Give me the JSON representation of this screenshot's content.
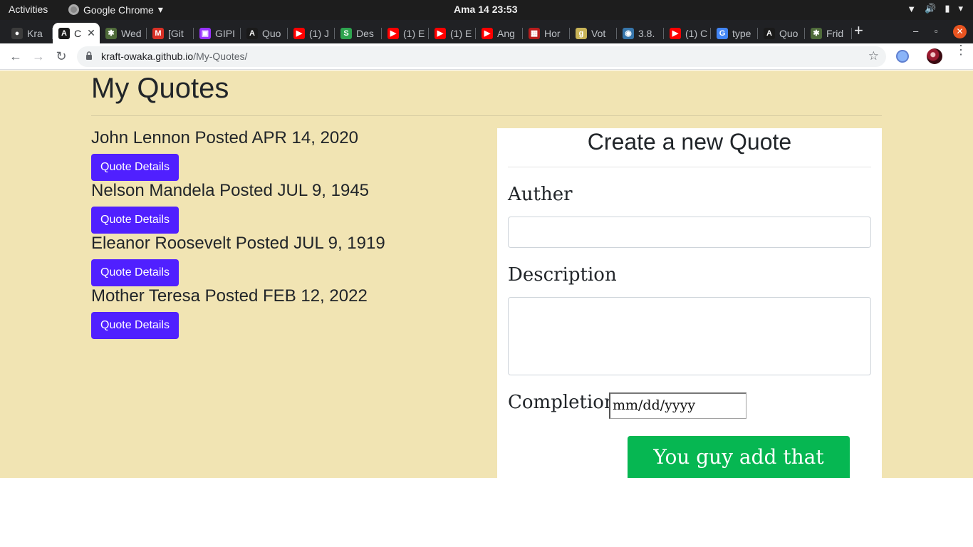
{
  "system_bar": {
    "activities": "Activities",
    "app_name": "Google Chrome",
    "clock": "Ama 14  23:53"
  },
  "tabs": [
    {
      "label": "Kra",
      "icon": "github-icon",
      "color": "#3c3c3c"
    },
    {
      "label": "C",
      "icon": "angular-icon",
      "color": "#1a1a1a",
      "active": true
    },
    {
      "label": "Wed",
      "icon": "palm-icon",
      "color": "#4f6b3a"
    },
    {
      "label": "[Git",
      "icon": "gmail-icon",
      "color": "#d93025"
    },
    {
      "label": "GIPI",
      "icon": "giphy-icon",
      "color": "#9933ff"
    },
    {
      "label": "Quo",
      "icon": "angular-icon",
      "color": "#1a1a1a"
    },
    {
      "label": "(1) J",
      "icon": "youtube-icon",
      "color": "#ff0000"
    },
    {
      "label": "Des",
      "icon": "stack-icon",
      "color": "#2ea44f"
    },
    {
      "label": "(1) E",
      "icon": "youtube-icon",
      "color": "#ff0000"
    },
    {
      "label": "(1) E",
      "icon": "youtube-icon",
      "color": "#ff0000"
    },
    {
      "label": "Ang",
      "icon": "youtube-icon",
      "color": "#ff0000"
    },
    {
      "label": "Hor",
      "icon": "grid-icon",
      "color": "#b71c1c"
    },
    {
      "label": "Vot",
      "icon": "g-icon",
      "color": "#c9b458"
    },
    {
      "label": "3.8.",
      "icon": "python-icon",
      "color": "#3776ab"
    },
    {
      "label": "(1) C",
      "icon": "youtube-icon",
      "color": "#ff0000"
    },
    {
      "label": "type",
      "icon": "google-icon",
      "color": "#4285f4"
    },
    {
      "label": "Quo",
      "icon": "angular-icon",
      "color": "#1a1a1a"
    },
    {
      "label": "Frid",
      "icon": "palm-icon",
      "color": "#4f6b3a"
    }
  ],
  "address_bar": {
    "host": "kraft-owaka.github.io",
    "path": "/My-Quotes/"
  },
  "page": {
    "title": "My Quotes",
    "quotes": [
      {
        "heading": "John Lennon Posted APR 14, 2020",
        "button": "Quote Details"
      },
      {
        "heading": "Nelson Mandela Posted JUL 9, 1945",
        "button": "Quote Details"
      },
      {
        "heading": "Eleanor Roosevelt Posted JUL 9, 1919",
        "button": "Quote Details"
      },
      {
        "heading": "Mother Teresa Posted FEB 12, 2022",
        "button": "Quote Details"
      }
    ],
    "form": {
      "title": "Create a new Quote",
      "author_label": "Auther",
      "author_value": "",
      "description_label": "Description",
      "description_value": "",
      "completion_label": "Completion",
      "completion_placeholder": "mm/dd/yyyy",
      "submit_label": "You guy add that Quote"
    }
  },
  "colors": {
    "page_background": "#f1e4b3",
    "details_button": "#5020ff",
    "submit_button": "#06b752"
  }
}
